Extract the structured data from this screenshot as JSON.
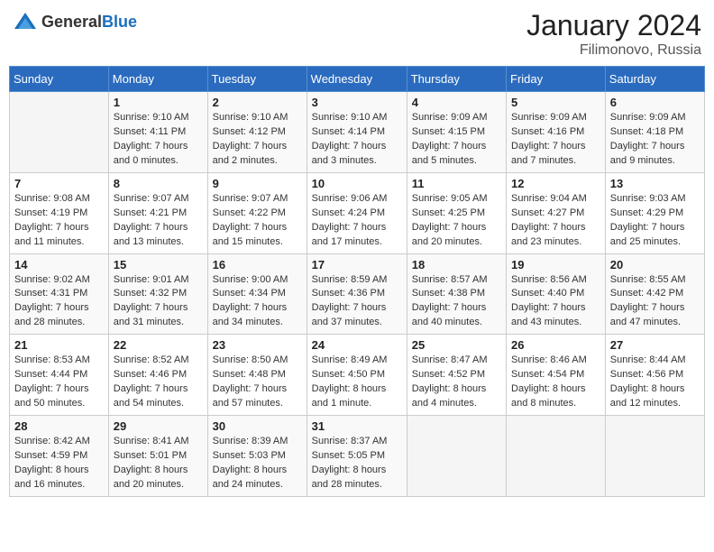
{
  "logo": {
    "general": "General",
    "blue": "Blue"
  },
  "title": "January 2024",
  "location": "Filimonovo, Russia",
  "days_of_week": [
    "Sunday",
    "Monday",
    "Tuesday",
    "Wednesday",
    "Thursday",
    "Friday",
    "Saturday"
  ],
  "weeks": [
    [
      {
        "day": "",
        "info": ""
      },
      {
        "day": "1",
        "info": "Sunrise: 9:10 AM\nSunset: 4:11 PM\nDaylight: 7 hours\nand 0 minutes."
      },
      {
        "day": "2",
        "info": "Sunrise: 9:10 AM\nSunset: 4:12 PM\nDaylight: 7 hours\nand 2 minutes."
      },
      {
        "day": "3",
        "info": "Sunrise: 9:10 AM\nSunset: 4:14 PM\nDaylight: 7 hours\nand 3 minutes."
      },
      {
        "day": "4",
        "info": "Sunrise: 9:09 AM\nSunset: 4:15 PM\nDaylight: 7 hours\nand 5 minutes."
      },
      {
        "day": "5",
        "info": "Sunrise: 9:09 AM\nSunset: 4:16 PM\nDaylight: 7 hours\nand 7 minutes."
      },
      {
        "day": "6",
        "info": "Sunrise: 9:09 AM\nSunset: 4:18 PM\nDaylight: 7 hours\nand 9 minutes."
      }
    ],
    [
      {
        "day": "7",
        "info": "Sunrise: 9:08 AM\nSunset: 4:19 PM\nDaylight: 7 hours\nand 11 minutes."
      },
      {
        "day": "8",
        "info": "Sunrise: 9:07 AM\nSunset: 4:21 PM\nDaylight: 7 hours\nand 13 minutes."
      },
      {
        "day": "9",
        "info": "Sunrise: 9:07 AM\nSunset: 4:22 PM\nDaylight: 7 hours\nand 15 minutes."
      },
      {
        "day": "10",
        "info": "Sunrise: 9:06 AM\nSunset: 4:24 PM\nDaylight: 7 hours\nand 17 minutes."
      },
      {
        "day": "11",
        "info": "Sunrise: 9:05 AM\nSunset: 4:25 PM\nDaylight: 7 hours\nand 20 minutes."
      },
      {
        "day": "12",
        "info": "Sunrise: 9:04 AM\nSunset: 4:27 PM\nDaylight: 7 hours\nand 23 minutes."
      },
      {
        "day": "13",
        "info": "Sunrise: 9:03 AM\nSunset: 4:29 PM\nDaylight: 7 hours\nand 25 minutes."
      }
    ],
    [
      {
        "day": "14",
        "info": "Sunrise: 9:02 AM\nSunset: 4:31 PM\nDaylight: 7 hours\nand 28 minutes."
      },
      {
        "day": "15",
        "info": "Sunrise: 9:01 AM\nSunset: 4:32 PM\nDaylight: 7 hours\nand 31 minutes."
      },
      {
        "day": "16",
        "info": "Sunrise: 9:00 AM\nSunset: 4:34 PM\nDaylight: 7 hours\nand 34 minutes."
      },
      {
        "day": "17",
        "info": "Sunrise: 8:59 AM\nSunset: 4:36 PM\nDaylight: 7 hours\nand 37 minutes."
      },
      {
        "day": "18",
        "info": "Sunrise: 8:57 AM\nSunset: 4:38 PM\nDaylight: 7 hours\nand 40 minutes."
      },
      {
        "day": "19",
        "info": "Sunrise: 8:56 AM\nSunset: 4:40 PM\nDaylight: 7 hours\nand 43 minutes."
      },
      {
        "day": "20",
        "info": "Sunrise: 8:55 AM\nSunset: 4:42 PM\nDaylight: 7 hours\nand 47 minutes."
      }
    ],
    [
      {
        "day": "21",
        "info": "Sunrise: 8:53 AM\nSunset: 4:44 PM\nDaylight: 7 hours\nand 50 minutes."
      },
      {
        "day": "22",
        "info": "Sunrise: 8:52 AM\nSunset: 4:46 PM\nDaylight: 7 hours\nand 54 minutes."
      },
      {
        "day": "23",
        "info": "Sunrise: 8:50 AM\nSunset: 4:48 PM\nDaylight: 7 hours\nand 57 minutes."
      },
      {
        "day": "24",
        "info": "Sunrise: 8:49 AM\nSunset: 4:50 PM\nDaylight: 8 hours\nand 1 minute."
      },
      {
        "day": "25",
        "info": "Sunrise: 8:47 AM\nSunset: 4:52 PM\nDaylight: 8 hours\nand 4 minutes."
      },
      {
        "day": "26",
        "info": "Sunrise: 8:46 AM\nSunset: 4:54 PM\nDaylight: 8 hours\nand 8 minutes."
      },
      {
        "day": "27",
        "info": "Sunrise: 8:44 AM\nSunset: 4:56 PM\nDaylight: 8 hours\nand 12 minutes."
      }
    ],
    [
      {
        "day": "28",
        "info": "Sunrise: 8:42 AM\nSunset: 4:59 PM\nDaylight: 8 hours\nand 16 minutes."
      },
      {
        "day": "29",
        "info": "Sunrise: 8:41 AM\nSunset: 5:01 PM\nDaylight: 8 hours\nand 20 minutes."
      },
      {
        "day": "30",
        "info": "Sunrise: 8:39 AM\nSunset: 5:03 PM\nDaylight: 8 hours\nand 24 minutes."
      },
      {
        "day": "31",
        "info": "Sunrise: 8:37 AM\nSunset: 5:05 PM\nDaylight: 8 hours\nand 28 minutes."
      },
      {
        "day": "",
        "info": ""
      },
      {
        "day": "",
        "info": ""
      },
      {
        "day": "",
        "info": ""
      }
    ]
  ]
}
